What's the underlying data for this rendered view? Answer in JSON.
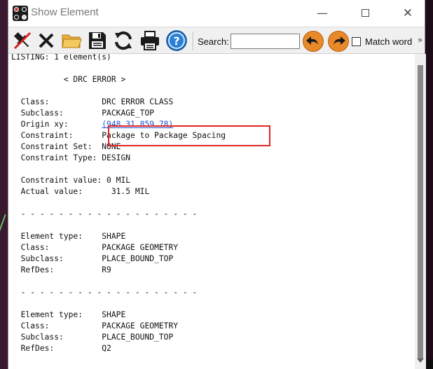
{
  "window": {
    "title": "Show Element"
  },
  "toolbar": {
    "icons": [
      "pin-icon",
      "close-x-icon",
      "folder-open-icon",
      "save-disk-icon",
      "refresh-icon",
      "print-icon",
      "help-icon"
    ],
    "search_label": "Search:",
    "search_value": "",
    "search_placeholder": "",
    "match_word_label": "Match word",
    "match_word_checked": false,
    "overflow_label": "»"
  },
  "listing": {
    "header": "LISTING: 1 element(s)",
    "section_title": "< DRC ERROR >",
    "drc": [
      {
        "key": "Class:",
        "value": "DRC ERROR CLASS"
      },
      {
        "key": "Subclass:",
        "value": "PACKAGE_TOP"
      },
      {
        "key": "Origin xy:",
        "value": "(948.31 859.78)"
      },
      {
        "key": "Constraint:",
        "value": "Package to Package Spacing"
      },
      {
        "key": "Constraint Set:",
        "value": "NONE"
      },
      {
        "key": "Constraint Type:",
        "value": "DESIGN"
      }
    ],
    "values": [
      {
        "key": "Constraint value:",
        "value": "0 MIL"
      },
      {
        "key": "Actual value:",
        "value": "31.5 MIL"
      }
    ],
    "divider": "- - - - - - - - - - - - - - - - - - -",
    "elements": [
      [
        {
          "key": "Element type:",
          "value": "SHAPE"
        },
        {
          "key": "Class:",
          "value": "PACKAGE GEOMETRY"
        },
        {
          "key": "Subclass:",
          "value": "PLACE_BOUND_TOP"
        },
        {
          "key": "RefDes:",
          "value": "R9"
        }
      ],
      [
        {
          "key": "Element type:",
          "value": "SHAPE"
        },
        {
          "key": "Class:",
          "value": "PACKAGE GEOMETRY"
        },
        {
          "key": "Subclass:",
          "value": "PLACE_BOUND_TOP"
        },
        {
          "key": "RefDes:",
          "value": "Q2"
        }
      ]
    ]
  },
  "colors": {
    "highlight_border": "#e02424",
    "link": "#1a4fcf",
    "nav_button": "#e98a2a"
  }
}
